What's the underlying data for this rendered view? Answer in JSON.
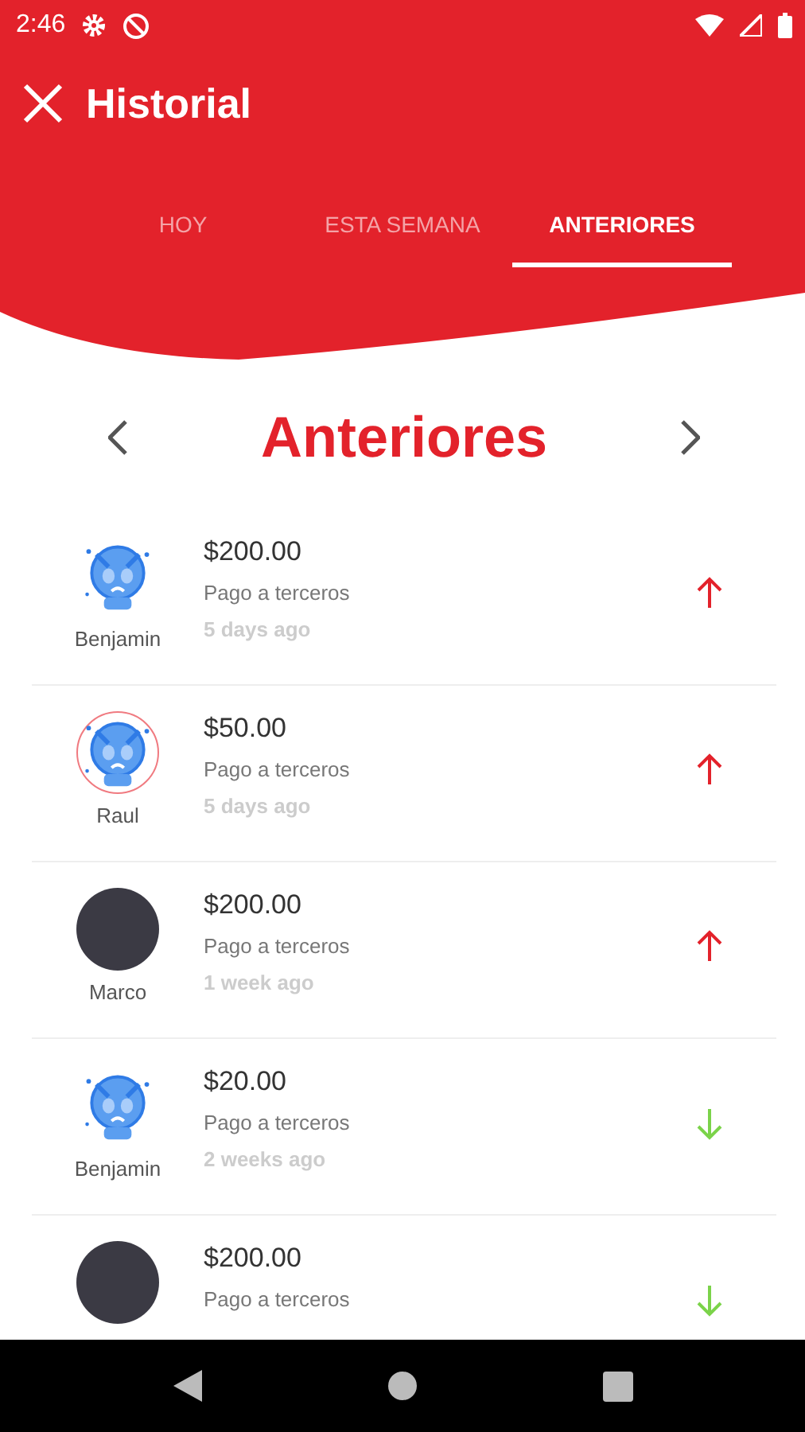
{
  "status_bar": {
    "time": "2:46"
  },
  "header": {
    "title": "Historial"
  },
  "tabs": [
    {
      "label": "HOY",
      "selected": false
    },
    {
      "label": "ESTA SEMANA",
      "selected": false
    },
    {
      "label": "ANTERIORES",
      "selected": true
    }
  ],
  "period": {
    "title": "Anteriores"
  },
  "transactions": [
    {
      "kind": "mascot",
      "outlined": false,
      "name": "Benjamin",
      "amount": "$200.00",
      "description": "Pago a terceros",
      "time": "5 days ago",
      "outgoing": true
    },
    {
      "kind": "mascot",
      "outlined": true,
      "name": "Raul",
      "amount": "$50.00",
      "description": "Pago a terceros",
      "time": "5 days ago",
      "outgoing": true
    },
    {
      "kind": "photo",
      "outlined": false,
      "name": "Marco",
      "amount": "$200.00",
      "description": "Pago a terceros",
      "time": "1 week ago",
      "outgoing": true
    },
    {
      "kind": "mascot",
      "outlined": false,
      "name": "Benjamin",
      "amount": "$20.00",
      "description": "Pago a terceros",
      "time": "2 weeks ago",
      "outgoing": false
    },
    {
      "kind": "photo",
      "outlined": false,
      "amount": "$200.00",
      "description": "Pago a terceros",
      "outgoing": false
    }
  ]
}
